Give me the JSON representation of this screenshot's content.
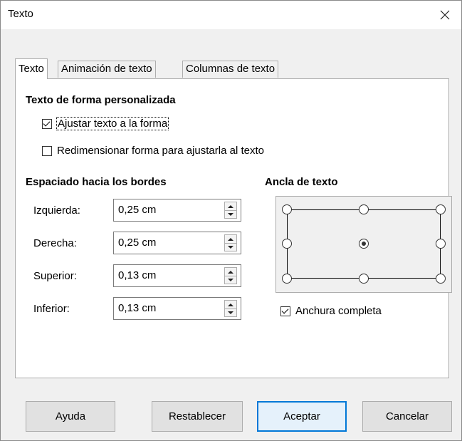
{
  "window": {
    "title": "Texto"
  },
  "tabs": [
    {
      "label": "Texto",
      "active": true
    },
    {
      "label": "Animación de texto",
      "active": false
    },
    {
      "label": "Columnas de texto",
      "active": false
    }
  ],
  "custom_shape": {
    "heading": "Texto de forma personalizada",
    "fit_text": {
      "label": "Ajustar texto a la forma",
      "checked": true
    },
    "resize_shape": {
      "label": "Redimensionar forma para ajustarla al texto",
      "checked": false
    }
  },
  "spacing": {
    "heading": "Espaciado hacia los bordes",
    "fields": [
      {
        "label": "Izquierda:",
        "value": "0,25 cm"
      },
      {
        "label": "Derecha:",
        "value": "0,25 cm"
      },
      {
        "label": "Superior:",
        "value": "0,13 cm"
      },
      {
        "label": "Inferior:",
        "value": "0,13 cm"
      }
    ]
  },
  "anchor": {
    "heading": "Ancla de texto",
    "selected": "center",
    "full_width": {
      "label": "Anchura completa",
      "checked": true
    }
  },
  "buttons": {
    "help": "Ayuda",
    "reset": "Restablecer",
    "ok": "Aceptar",
    "cancel": "Cancelar"
  },
  "colors": {
    "accent": "#0078d7",
    "dialog_bg": "#f0f0f0",
    "panel_bg": "#ffffff"
  }
}
